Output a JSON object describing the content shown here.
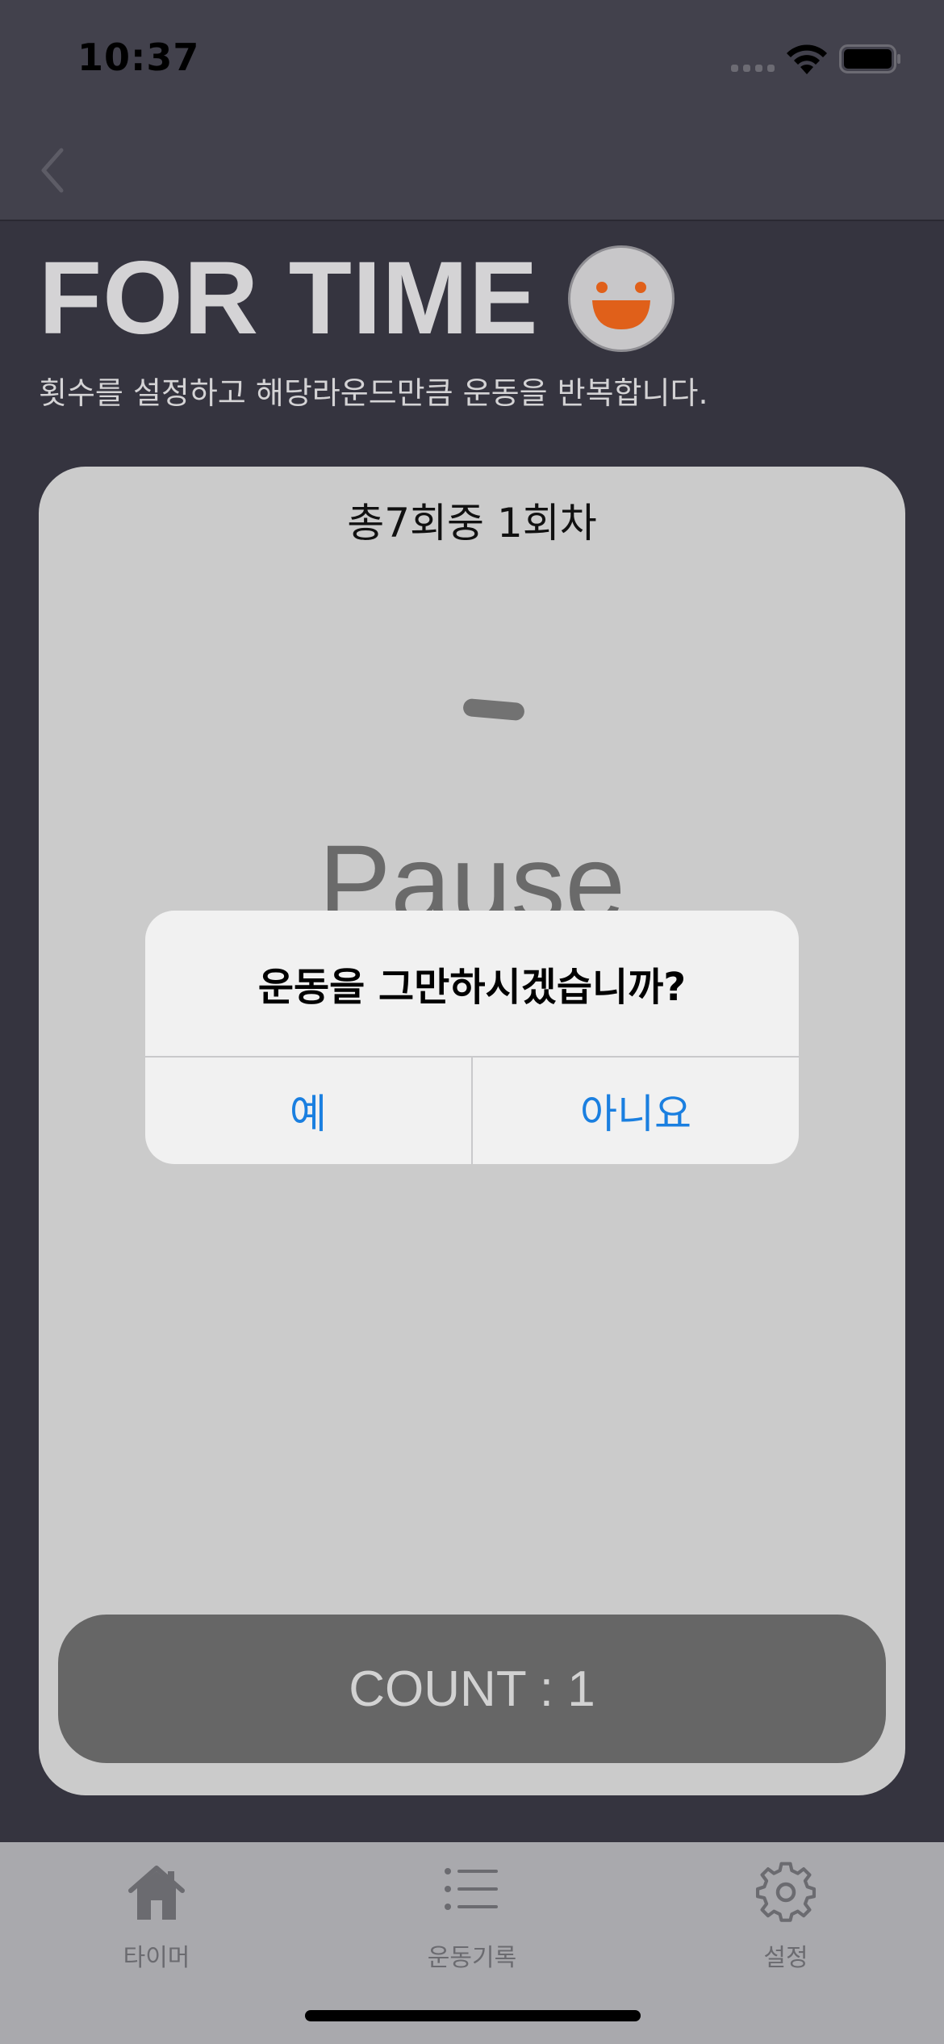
{
  "status_bar": {
    "time": "10:37"
  },
  "nav": {
    "back_icon": "chevron-left-icon"
  },
  "header": {
    "title": "FOR TIME",
    "subtitle": "횟수를 설정하고 해당라운드만큼 운동을 반복합니다.",
    "emoji_icon": "smiley-face-icon"
  },
  "card": {
    "round_text": "총7회중 1회차",
    "state_text": "Pause",
    "count_label": "COUNT : 1"
  },
  "alert": {
    "message": "운동을 그만하시겠습니까?",
    "yes_label": "예",
    "no_label": "아니요"
  },
  "tab_bar": {
    "items": [
      {
        "label": "타이머",
        "icon": "home-icon"
      },
      {
        "label": "운동기록",
        "icon": "list-icon"
      },
      {
        "label": "설정",
        "icon": "gear-icon"
      }
    ]
  },
  "colors": {
    "background": "#35343f",
    "card": "#cbcbcb",
    "accent_blue": "#1a7fe0",
    "emoji_orange": "#e0601a"
  }
}
